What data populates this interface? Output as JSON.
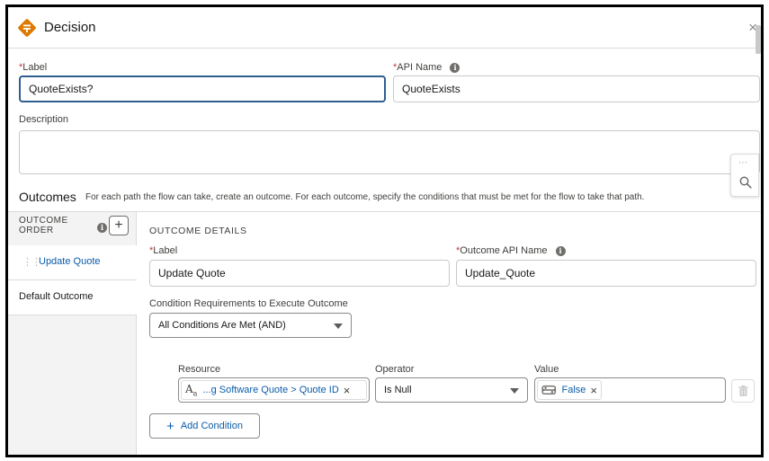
{
  "header": {
    "title": "Decision",
    "close_label": "×"
  },
  "form": {
    "label_label": "Label",
    "label_value": "QuoteExists?",
    "api_name_label": "API Name",
    "api_name_value": "QuoteExists",
    "description_label": "Description",
    "required_mark": "*"
  },
  "outcomes": {
    "title": "Outcomes",
    "description": "For each path the flow can take, create an outcome. For each outcome, specify the conditions that must be met for the flow to take that path.",
    "order_label": "OUTCOME ORDER",
    "add_label": "+",
    "items": [
      {
        "label": "Update Quote"
      },
      {
        "label": "Default Outcome"
      }
    ]
  },
  "details": {
    "title": "OUTCOME DETAILS",
    "label_label": "Label",
    "label_value": "Update Quote",
    "api_name_label": "Outcome API Name",
    "api_name_value": "Update_Quote",
    "condition_req_label": "Condition Requirements to Execute Outcome",
    "condition_req_value": "All Conditions Are Met (AND)",
    "condition": {
      "resource_label": "Resource",
      "resource_value": "...g Software Quote > Quote ID",
      "operator_label": "Operator",
      "operator_value": "Is Null",
      "value_label": "Value",
      "value_value": "False"
    },
    "add_condition_label": "Add Condition"
  },
  "colors": {
    "accent": "#0b5cab",
    "decision_icon": "#dd7a01",
    "focus_border": "#2e5f8f"
  }
}
